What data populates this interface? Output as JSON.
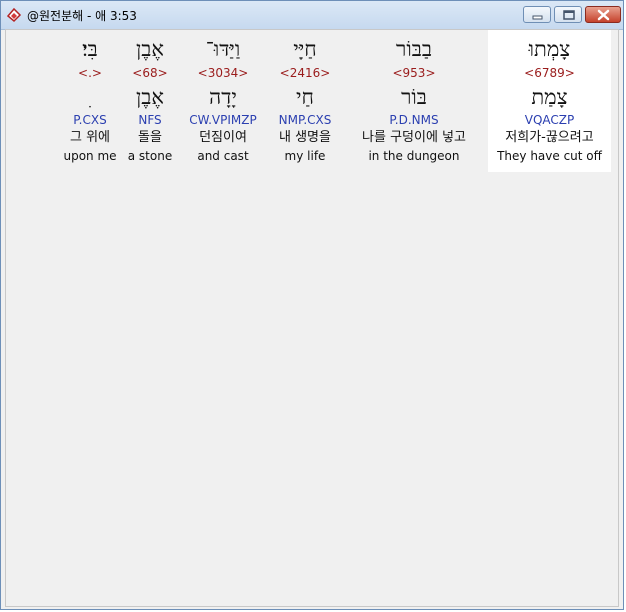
{
  "window": {
    "title": "@원전분해 - 애 3:53"
  },
  "words": [
    {
      "hebrew": "צָמְתוּ",
      "strong": "<6789>",
      "lemma": "צָמַת",
      "parse": "VQACZP",
      "korean": "저희가-끊으려고",
      "english": "They have cut off"
    },
    {
      "hebrew": "בַבּוֹר",
      "strong": "<953>",
      "lemma": "בּוֹר",
      "parse": "P.D.NMS",
      "korean": "나를 구덩이에 넣고",
      "english": "in the dungeon"
    },
    {
      "hebrew": "חַיָּי",
      "strong": "<2416>",
      "lemma": "חַי",
      "parse": "NMP.CXS",
      "korean": "내 생명을",
      "english": "my life"
    },
    {
      "hebrew": "וַיַּדּוּ־",
      "strong": "<3034>",
      "lemma": "יָדָה",
      "parse": "CW.VPIMZP",
      "korean": "던짐이여",
      "english": "and cast"
    },
    {
      "hebrew": "אֶבֶן",
      "strong": "<68>",
      "lemma": "אֶבֶן",
      "parse": "NFS",
      "korean": "돌을",
      "english": "a stone"
    },
    {
      "hebrew": "בִּי׃",
      "strong": "<.>",
      "lemma": "ִ",
      "parse": "P.CXS",
      "korean": "그 위에",
      "english": "upon me"
    }
  ]
}
